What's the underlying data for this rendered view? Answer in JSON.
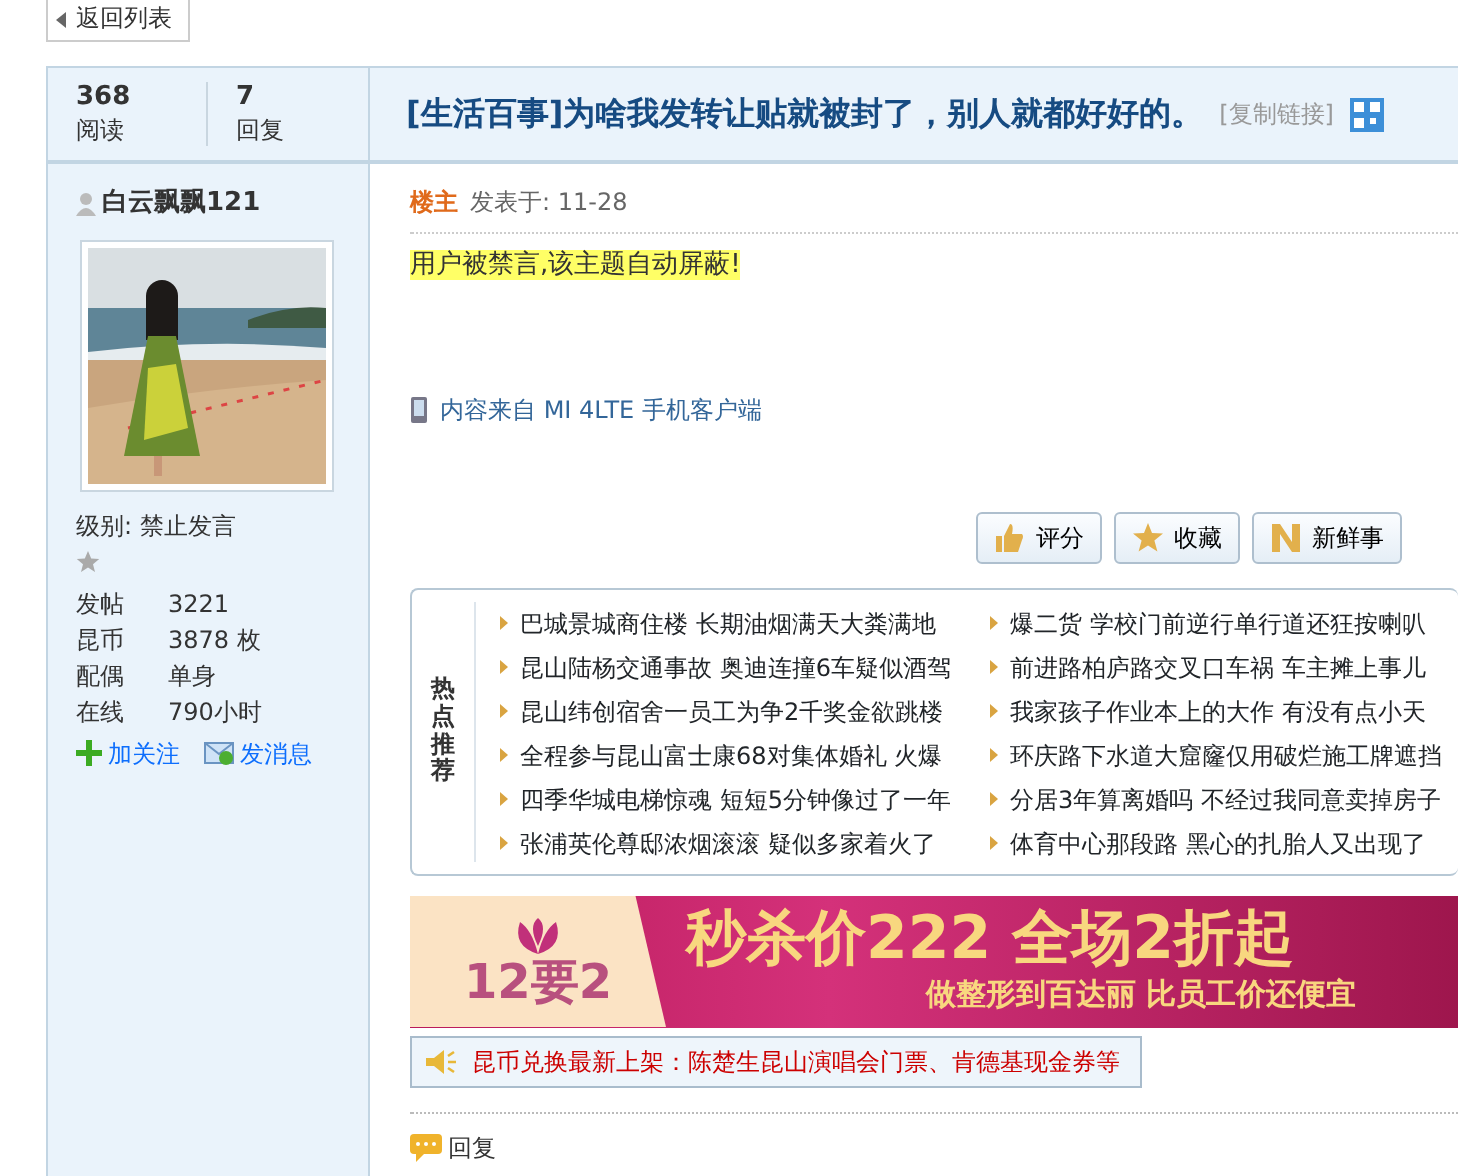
{
  "back_button": "返回列表",
  "stats": [
    {
      "value": "368",
      "label": "阅读"
    },
    {
      "value": "7",
      "label": "回复"
    }
  ],
  "title": "[生活百事]为啥我发转让贴就被封了，别人就都好好的。",
  "copy_link": "[复制链接]",
  "author": {
    "name": "白云飘飘121",
    "level": "级别: 禁止发言",
    "fields": [
      {
        "label": "发帖",
        "value": "3221"
      },
      {
        "label": "昆币",
        "value": "3878 枚"
      },
      {
        "label": "配偶",
        "value": "单身"
      },
      {
        "label": "在线",
        "value": "790小时"
      }
    ],
    "actions": [
      {
        "kind": "follow",
        "label": "加关注"
      },
      {
        "kind": "message",
        "label": "发消息"
      }
    ]
  },
  "post": {
    "floor": "楼主",
    "posted": "发表于: 11-28",
    "notice": "用户被禁言,该主题自动屏蔽!",
    "source": "内容来自 MI 4LTE 手机客户端",
    "buttons": [
      {
        "kind": "rate",
        "label": "评分"
      },
      {
        "kind": "favorite",
        "label": "收藏"
      },
      {
        "kind": "news",
        "label": "新鲜事"
      }
    ]
  },
  "hot": {
    "title": "热点推荐",
    "items": [
      "巴城景城商住楼 长期油烟满天大粪满地",
      "爆二货 学校门前逆行单行道还狂按喇叭",
      "昆山陆杨交通事故 奥迪连撞6车疑似酒驾",
      "前进路柏庐路交叉口车祸 车主摊上事儿",
      "昆山纬创宿舍一员工为争2千奖金欲跳楼",
      "我家孩子作业本上的大作 有没有点小天",
      "全程参与昆山富士康68对集体婚礼 火爆",
      "环庆路下水道大窟窿仅用破烂施工牌遮挡",
      "四季华城电梯惊魂 短短5分钟像过了一年",
      "分居3年算离婚吗 不经过我同意卖掉房子",
      "张浦英伦尊邸浓烟滚滚 疑似多家着火了",
      "体育中心那段路 黑心的扎胎人又出现了"
    ]
  },
  "banner": {
    "badge": "12要2",
    "headline": "秒杀价222 全场2折起",
    "subline": "做整形到百达丽 比员工价还便宜"
  },
  "announcement": "昆币兑换最新上架：陈楚生昆山演唱会门票、肯德基现金券等",
  "reply_label": "回复"
}
